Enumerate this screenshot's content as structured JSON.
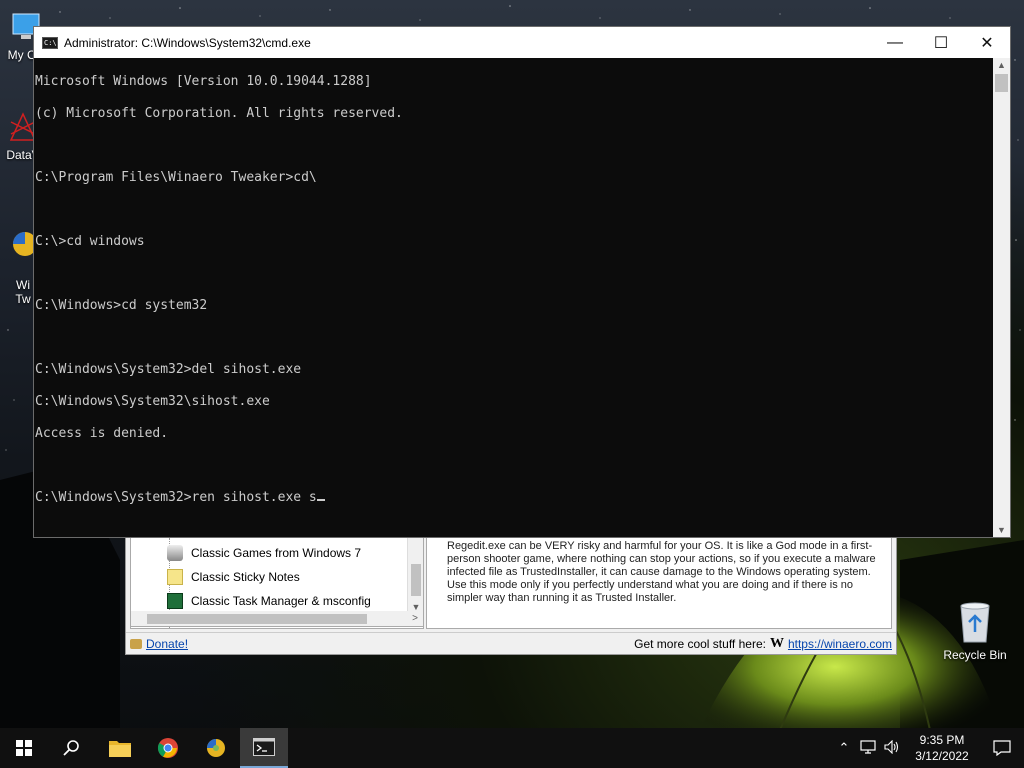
{
  "desktop": {
    "icons": [
      {
        "label": "My Co",
        "icon": "computer-icon"
      },
      {
        "label": "DataV",
        "icon": "datavis-icon"
      },
      {
        "label": "Wi\nTw",
        "icon": "winaero-tweaker-icon"
      }
    ],
    "recycle_bin": {
      "label": "Recycle Bin",
      "icon": "recycle-bin-icon"
    }
  },
  "cmd": {
    "title": "Administrator: C:\\Windows\\System32\\cmd.exe",
    "lines": [
      "Microsoft Windows [Version 10.0.19044.1288]",
      "(c) Microsoft Corporation. All rights reserved.",
      "",
      "C:\\Program Files\\Winaero Tweaker>cd\\",
      "",
      "C:\\>cd windows",
      "",
      "C:\\Windows>cd system32",
      "",
      "C:\\Windows\\System32>del sihost.exe",
      "C:\\Windows\\System32\\sihost.exe",
      "Access is denied.",
      "",
      "C:\\Windows\\System32>ren sihost.exe s"
    ],
    "controls": {
      "minimize": "—",
      "maximize": "☐",
      "close": "✕"
    }
  },
  "tweaker": {
    "tree_items": [
      {
        "label": "Classic Games from Windows 7",
        "icon": "games-icon"
      },
      {
        "label": "Classic Sticky Notes",
        "icon": "sticky-notes-icon"
      },
      {
        "label": "Classic Task Manager & msconfig",
        "icon": "task-manager-icon"
      }
    ],
    "description": "Regedit.exe can be VERY risky and harmful for your OS. It is like a God mode in a first-person shooter game, where nothing can stop your actions, so if you execute a malware infected file as TrustedInstaller, it can cause damage to the Windows operating system. Use this mode only if you perfectly understand what you are doing and if there is no simpler way than running it as Trusted Installer.",
    "donate_label": "Donate!",
    "more_label": "Get more cool stuff here:",
    "link_label": "https://winaero.com"
  },
  "taskbar": {
    "apps": [
      "start-icon",
      "search-icon",
      "file-explorer-icon",
      "chrome-icon",
      "winaero-tweaker-icon",
      "cmd-icon"
    ],
    "time": "9:35 PM",
    "date": "3/12/2022"
  }
}
